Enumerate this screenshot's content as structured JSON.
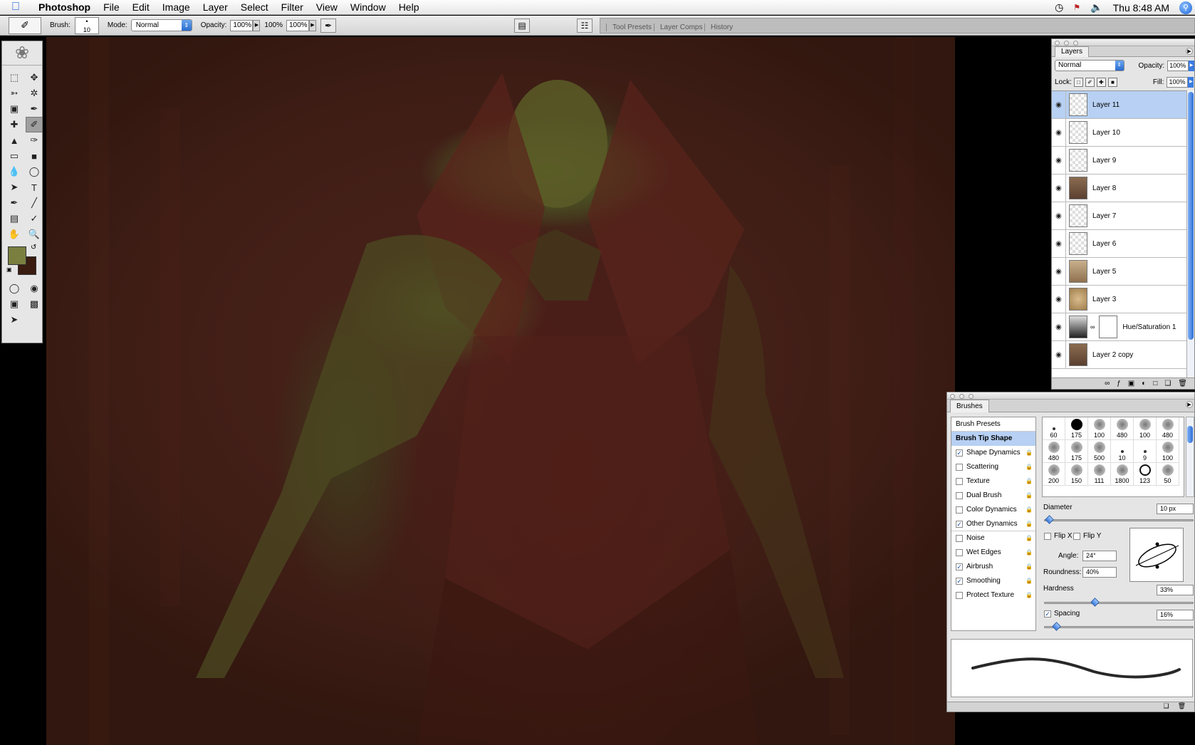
{
  "menubar": {
    "app": "Photoshop",
    "menus": [
      "File",
      "Edit",
      "Image",
      "Layer",
      "Select",
      "Filter",
      "View",
      "Window",
      "Help"
    ],
    "clock": "Thu 8:48 AM"
  },
  "options": {
    "brush_label": "Brush:",
    "brush_size": "10",
    "mode_label": "Mode:",
    "mode_value": "Normal",
    "opacity_label": "Opacity:",
    "opacity_value": "100%",
    "flow_label": "100%",
    "flow_value": "100%",
    "well_tabs": [
      "Tool Presets",
      "Layer Comps",
      "History"
    ]
  },
  "tools": {
    "foreground_color": "#7a7f40",
    "background_color": "#3a1c10"
  },
  "layers_panel": {
    "tab": "Layers",
    "blend_mode": "Normal",
    "opacity_label": "Opacity:",
    "opacity_value": "100%",
    "lock_label": "Lock:",
    "fill_label": "Fill:",
    "fill_value": "100%",
    "layers": [
      {
        "name": "Layer 11",
        "selected": true
      },
      {
        "name": "Layer 10"
      },
      {
        "name": "Layer 9"
      },
      {
        "name": "Layer 8"
      },
      {
        "name": "Layer 7"
      },
      {
        "name": "Layer 6"
      },
      {
        "name": "Layer 5"
      },
      {
        "name": "Layer 3"
      },
      {
        "name": "Hue/Saturation 1"
      },
      {
        "name": "Layer 2 copy"
      }
    ]
  },
  "brushes_panel": {
    "tab": "Brushes",
    "presets": "Brush Presets",
    "tip_shape": "Brush Tip Shape",
    "options": [
      {
        "label": "Shape Dynamics",
        "checked": true
      },
      {
        "label": "Scattering",
        "checked": false
      },
      {
        "label": "Texture",
        "checked": false
      },
      {
        "label": "Dual Brush",
        "checked": false
      },
      {
        "label": "Color Dynamics",
        "checked": false
      },
      {
        "label": "Other Dynamics",
        "checked": true
      },
      {
        "label": "Noise",
        "checked": false
      },
      {
        "label": "Wet Edges",
        "checked": false
      },
      {
        "label": "Airbrush",
        "checked": true
      },
      {
        "label": "Smoothing",
        "checked": true
      },
      {
        "label": "Protect Texture",
        "checked": false
      }
    ],
    "tip_sizes": [
      "60",
      "175",
      "100",
      "480",
      "100",
      "480",
      "480",
      "175",
      "500",
      "10",
      "9",
      "100",
      "200",
      "150",
      "111",
      "1800",
      "123",
      "50"
    ],
    "diameter_label": "Diameter",
    "diameter_value": "10 px",
    "flip_x": "Flip X",
    "flip_y": "Flip Y",
    "angle_label": "Angle:",
    "angle_value": "24°",
    "roundness_label": "Roundness:",
    "roundness_value": "40%",
    "hardness_label": "Hardness",
    "hardness_value": "33%",
    "spacing_label": "Spacing",
    "spacing_value": "16%"
  }
}
